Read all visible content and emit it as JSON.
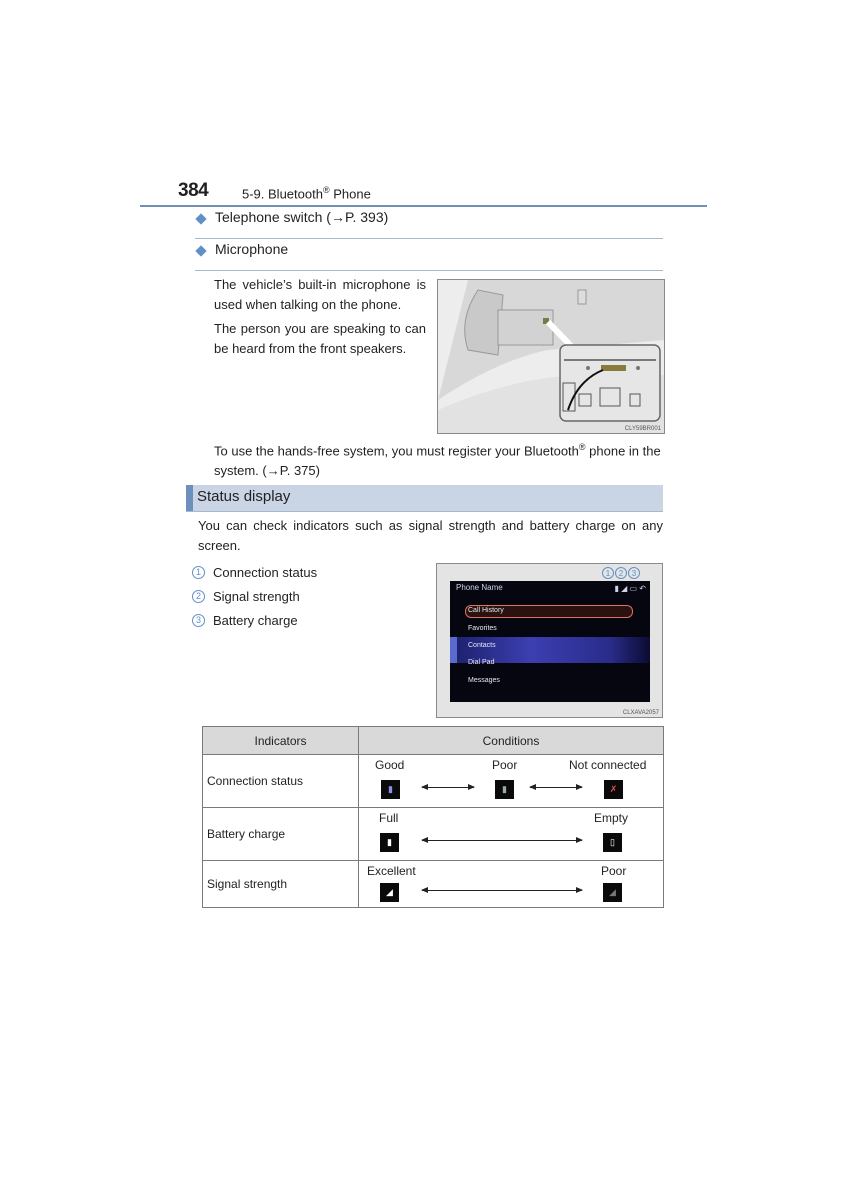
{
  "header": {
    "page_number": "384",
    "chapter": "5-9. Bluetooth",
    "chapter_mark": "®",
    "chapter_suffix": " Phone"
  },
  "items": [
    {
      "label": "Telephone switch (→P. 393)"
    },
    {
      "label": "Microphone"
    }
  ],
  "microphone": {
    "paragraphs": [
      "The vehicle’s built-in microphone is used when talking on the phone.",
      "The person you are speaking to can be heard from the front speakers."
    ],
    "figure_code": "CLY59BR001",
    "note_prefix": "To use the hands-free system, you must register your Bluetooth",
    "note_mark": "®",
    "note_suffix": " phone in the system. (→P. 375)"
  },
  "status_display": {
    "title": "Status display",
    "intro": "You can check indicators such as signal strength and battery charge on any screen.",
    "list": [
      {
        "num": "1",
        "label": "Connection status"
      },
      {
        "num": "2",
        "label": "Signal strength"
      },
      {
        "num": "3",
        "label": "Battery charge"
      }
    ],
    "screen": {
      "title": "Phone Name",
      "callouts": [
        "1",
        "2",
        "3"
      ],
      "menu": [
        "Call History",
        "Favorites",
        "Contacts",
        "Dial Pad",
        "Messages"
      ],
      "selected": "Call History",
      "figure_code": "CLXAVA2057"
    }
  },
  "table": {
    "headers": [
      "Indicators",
      "Conditions"
    ],
    "rows": [
      {
        "indicator": "Connection status",
        "conditions": [
          "Good",
          "Poor",
          "Not connected"
        ]
      },
      {
        "indicator": "Battery charge",
        "conditions": [
          "Full",
          "Empty"
        ]
      },
      {
        "indicator": "Signal strength",
        "conditions": [
          "Excellent",
          "Poor"
        ]
      }
    ]
  }
}
